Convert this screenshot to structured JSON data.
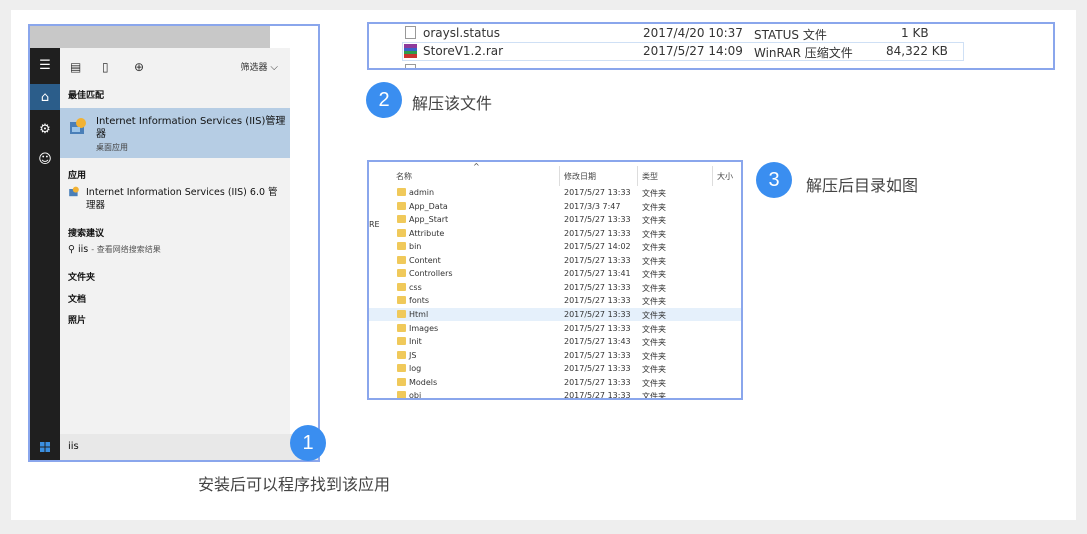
{
  "startmenu": {
    "filter_label": "筛选器",
    "best_match_header": "最佳匹配",
    "best_match_title": "Internet Information Services (IIS)管理器",
    "best_match_sub": "桌面应用",
    "apps_header": "应用",
    "app_item": "Internet Information Services (IIS) 6.0 管理器",
    "search_suggest_header": "搜索建议",
    "search_query": "iis",
    "search_suggest_text": "- 查看网络搜索结果",
    "folders_header": "文件夹",
    "documents_header": "文档",
    "photos_header": "照片",
    "search_box_value": "iis"
  },
  "rar": {
    "rows": [
      {
        "name": "oraysl.status",
        "date": "2017/4/20 10:37",
        "type": "STATUS 文件",
        "size": "1 KB"
      },
      {
        "name": "StoreV1.2.rar",
        "date": "2017/5/27 14:09",
        "type": "WinRAR 压缩文件",
        "size": "84,322 KB"
      }
    ]
  },
  "folders": {
    "col_name": "名称",
    "col_date": "修改日期",
    "col_type": "类型",
    "col_size": "大小",
    "left_cut": "RE",
    "rows": [
      {
        "name": "admin",
        "date": "2017/5/27 13:33",
        "type": "文件夹"
      },
      {
        "name": "App_Data",
        "date": "2017/3/3 7:47",
        "type": "文件夹"
      },
      {
        "name": "App_Start",
        "date": "2017/5/27 13:33",
        "type": "文件夹"
      },
      {
        "name": "Attribute",
        "date": "2017/5/27 13:33",
        "type": "文件夹"
      },
      {
        "name": "bin",
        "date": "2017/5/27 14:02",
        "type": "文件夹"
      },
      {
        "name": "Content",
        "date": "2017/5/27 13:33",
        "type": "文件夹"
      },
      {
        "name": "Controllers",
        "date": "2017/5/27 13:41",
        "type": "文件夹"
      },
      {
        "name": "css",
        "date": "2017/5/27 13:33",
        "type": "文件夹"
      },
      {
        "name": "fonts",
        "date": "2017/5/27 13:33",
        "type": "文件夹"
      },
      {
        "name": "Html",
        "date": "2017/5/27 13:33",
        "type": "文件夹"
      },
      {
        "name": "Images",
        "date": "2017/5/27 13:33",
        "type": "文件夹"
      },
      {
        "name": "Init",
        "date": "2017/5/27 13:43",
        "type": "文件夹"
      },
      {
        "name": "JS",
        "date": "2017/5/27 13:33",
        "type": "文件夹"
      },
      {
        "name": "log",
        "date": "2017/5/27 13:33",
        "type": "文件夹"
      },
      {
        "name": "Models",
        "date": "2017/5/27 13:33",
        "type": "文件夹"
      },
      {
        "name": "obj",
        "date": "2017/5/27 13:33",
        "type": "文件夹"
      }
    ]
  },
  "steps": [
    {
      "number": "1",
      "caption": "安装后可以程序找到该应用"
    },
    {
      "number": "2",
      "caption": "解压该文件"
    },
    {
      "number": "3",
      "caption": "解压后目录如图"
    }
  ],
  "colors": {
    "frame": "#8aa6ec",
    "badge": "#3a8ef0",
    "folder": "#f0c95a",
    "highlight": "#b6cde4"
  },
  "icons": [
    "hamburger-icon",
    "home-icon",
    "settings-icon",
    "person-icon",
    "document-icon",
    "new-doc-icon",
    "globe-icon",
    "chevron-down-icon",
    "iis-app-icon",
    "search-icon",
    "windows-icon",
    "cortana-icon",
    "folder-icon",
    "file-icon",
    "winrar-icon",
    "sort-arrow-icon"
  ]
}
